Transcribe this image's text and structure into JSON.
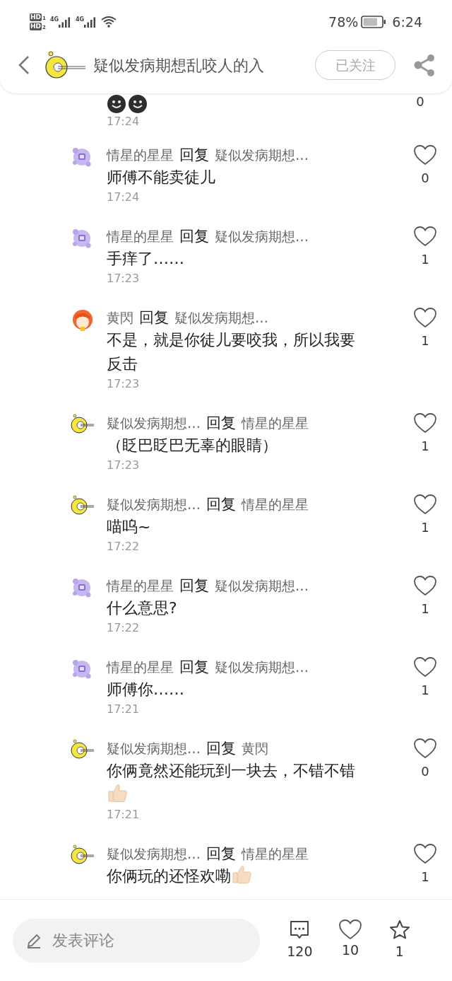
{
  "status_bar": {
    "sims": [
      {
        "label": "HD",
        "slot": "1"
      },
      {
        "label": "HD",
        "slot": "2"
      }
    ],
    "networks": [
      "4G",
      "4G"
    ],
    "battery": "78%",
    "time": "6:24"
  },
  "header": {
    "title": "疑似发病期想乱咬人的入",
    "follow_label": "已关注",
    "followed": true
  },
  "partial_comment": {
    "icons": [
      {
        "kind": "dark_smiley"
      },
      {
        "kind": "dark_smiley"
      }
    ],
    "time": "17:24",
    "likes": "0"
  },
  "comments": [
    {
      "avatar": {
        "kind": "purple"
      },
      "author": "情星的星星",
      "reply_word": "回复",
      "target": "疑似发病期想…",
      "text": "师傅不能卖徒儿",
      "time": "17:24",
      "likes": "0",
      "liked": false
    },
    {
      "avatar": {
        "kind": "purple"
      },
      "author": "情星的星星",
      "reply_word": "回复",
      "target": "疑似发病期想…",
      "text": "手痒了……",
      "time": "17:23",
      "likes": "1",
      "liked": false
    },
    {
      "avatar": {
        "kind": "orange"
      },
      "author": "黄閃",
      "reply_word": "回复",
      "target": "疑似发病期想…",
      "text": "不是，就是你徒儿要咬我，所以我要反击",
      "time": "17:23",
      "likes": "1",
      "liked": false
    },
    {
      "avatar": {
        "kind": "yellow"
      },
      "author": "疑似发病期想…",
      "reply_word": "回复",
      "target": "情星的星星",
      "text": "（眨巴眨巴无辜的眼睛）",
      "time": "17:23",
      "likes": "1",
      "liked": false
    },
    {
      "avatar": {
        "kind": "yellow"
      },
      "author": "疑似发病期想…",
      "reply_word": "回复",
      "target": "情星的星星",
      "text": "喵呜~",
      "time": "17:22",
      "likes": "1",
      "liked": false
    },
    {
      "avatar": {
        "kind": "purple"
      },
      "author": "情星的星星",
      "reply_word": "回复",
      "target": "疑似发病期想…",
      "text": "什么意思?",
      "time": "17:22",
      "likes": "1",
      "liked": false
    },
    {
      "avatar": {
        "kind": "purple"
      },
      "author": "情星的星星",
      "reply_word": "回复",
      "target": "疑似发病期想…",
      "text": "师傅你……",
      "time": "17:21",
      "likes": "1",
      "liked": false
    },
    {
      "avatar": {
        "kind": "yellow"
      },
      "author": "疑似发病期想…",
      "reply_word": "回复",
      "target": "黄閃",
      "text": "你俩竟然还能玩到一块去，不错不错",
      "icons": [
        {
          "kind": "thumbs_up"
        }
      ],
      "time": "17:21",
      "likes": "0",
      "liked": false
    },
    {
      "avatar": {
        "kind": "yellow"
      },
      "author": "疑似发病期想…",
      "reply_word": "回复",
      "target": "情星的星星",
      "text": "你俩玩的还怪欢嘞",
      "icons": [
        {
          "kind": "thumbs_up"
        }
      ],
      "likes": "1",
      "liked": false
    }
  ],
  "bottom_bar": {
    "placeholder": "发表评论",
    "comments": "120",
    "likes": "10",
    "favorites": "1"
  }
}
